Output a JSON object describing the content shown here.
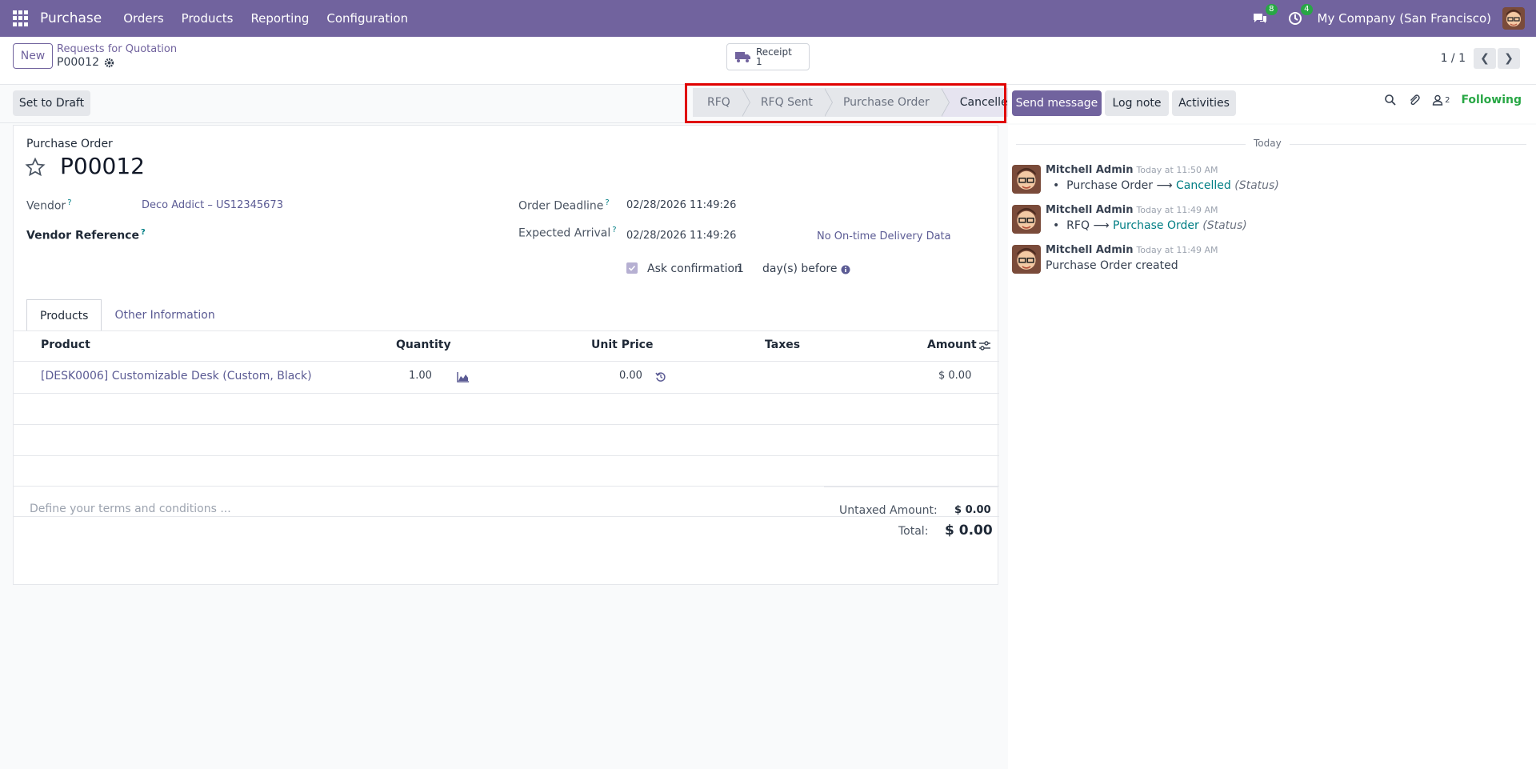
{
  "navbar": {
    "app_name": "Purchase",
    "menu": [
      "Orders",
      "Products",
      "Reporting",
      "Configuration"
    ],
    "messages_count": "8",
    "activities_count": "4",
    "company": "My Company (San Francisco)"
  },
  "control_panel": {
    "new_label": "New",
    "breadcrumb": "Requests for Quotation",
    "record_name": "P00012",
    "receipt_label": "Receipt",
    "receipt_count": "1",
    "pager": "1 / 1"
  },
  "statusbar": {
    "set_to_draft": "Set to Draft",
    "stages": [
      "RFQ",
      "RFQ Sent",
      "Purchase Order",
      "Cancelled"
    ],
    "active_stage": "Cancelled"
  },
  "chatter": {
    "send_message": "Send message",
    "log_note": "Log note",
    "activities": "Activities",
    "followers_count": "2",
    "following": "Following",
    "date_separator": "Today",
    "messages": [
      {
        "author": "Mitchell Admin",
        "time": "Today at 11:50 AM",
        "old": "Purchase Order",
        "arrow": "⟶",
        "new": "Cancelled",
        "field": "(Status)"
      },
      {
        "author": "Mitchell Admin",
        "time": "Today at 11:49 AM",
        "old": "RFQ",
        "arrow": "⟶",
        "new": "Purchase Order",
        "field": "(Status)"
      },
      {
        "author": "Mitchell Admin",
        "time": "Today at 11:49 AM",
        "body": "Purchase Order created"
      }
    ]
  },
  "form": {
    "type_label": "Purchase Order",
    "name": "P00012",
    "vendor_label": "Vendor",
    "vendor_value": "Deco Addict – US12345673",
    "vendor_ref_label": "Vendor Reference",
    "help_mark": "?",
    "order_deadline_label": "Order Deadline",
    "order_deadline_value": "02/28/2026 11:49:26",
    "expected_arrival_label": "Expected Arrival",
    "expected_arrival_value": "02/28/2026 11:49:26",
    "ontime_label": "No On-time Delivery Data",
    "ask_confirmation_label": "Ask confirmation",
    "ask_confirmation_days": "1",
    "days_before": "day(s) before",
    "tabs": [
      "Products",
      "Other Information"
    ],
    "columns": [
      "Product",
      "Quantity",
      "Unit Price",
      "Taxes",
      "Amount"
    ],
    "lines": [
      {
        "product": "[DESK0006] Customizable Desk (Custom, Black)",
        "quantity": "1.00",
        "unit_price": "0.00",
        "taxes": "",
        "amount": "$ 0.00"
      }
    ],
    "terms_placeholder": "Define your terms and conditions ...",
    "untaxed_label": "Untaxed Amount:",
    "untaxed_value": "$ 0.00",
    "total_label": "Total:",
    "total_value": "$ 0.00"
  },
  "colors": {
    "brand": "#71639e",
    "highlight": "#e00000",
    "following": "#28a745",
    "link_teal": "#017e84"
  }
}
